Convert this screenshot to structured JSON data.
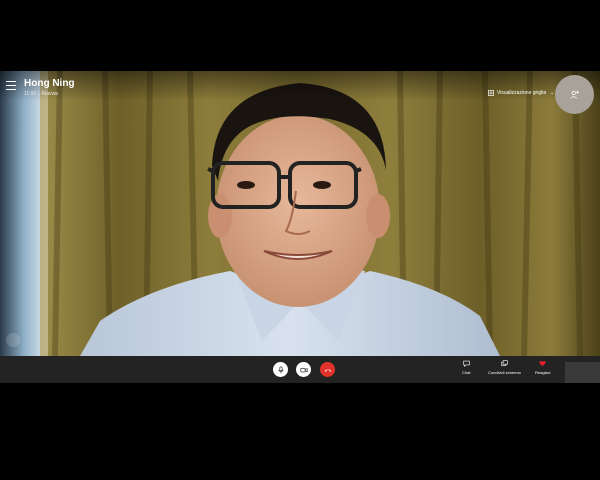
{
  "header": {
    "caller_name": "Hong Ning",
    "call_time": "11:00",
    "separator": "|",
    "call_status": "Riavvia"
  },
  "view": {
    "grid_label": "Visualizzazione griglia"
  },
  "controls": {
    "chat_label": "Chat",
    "share_label": "Condividi schermo",
    "react_label": "Reagisci"
  },
  "colors": {
    "hangup": "#e1332c",
    "heart": "#e81f2b",
    "control_bar": "#232323",
    "curtain": "#8a7a3a"
  },
  "icons": {
    "menu": "hamburger-icon",
    "grid": "grid-icon",
    "add_person": "add-person-icon",
    "mic": "microphone-icon",
    "video": "video-camera-icon",
    "hangup": "phone-hangup-icon",
    "chat": "chat-bubble-icon",
    "share": "share-screen-icon",
    "react": "heart-icon"
  }
}
